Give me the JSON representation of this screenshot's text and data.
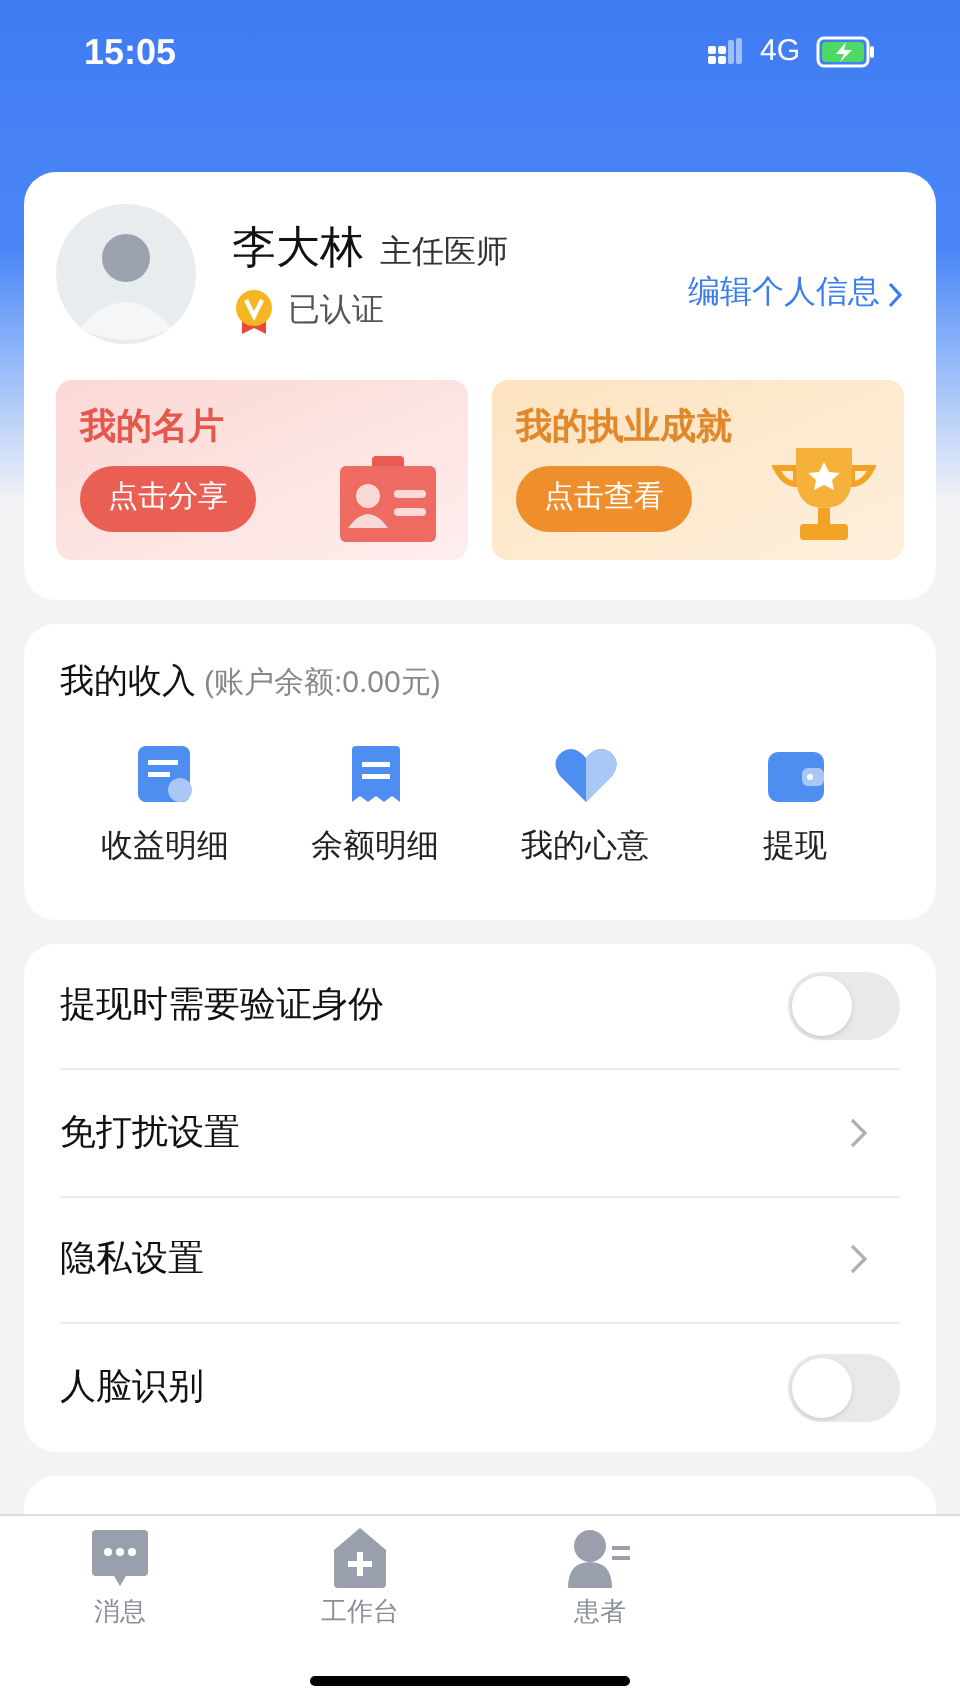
{
  "status_bar": {
    "time": "15:05",
    "network": "4G"
  },
  "profile": {
    "name": "李大林",
    "title": "主任医师",
    "verified": true,
    "verified_label": "已认证",
    "edit_link": "编辑个人信息"
  },
  "promo_cards": [
    {
      "kind": "card",
      "title": "我的名片",
      "button": "点击分享"
    },
    {
      "kind": "trophy",
      "title": "我的执业成就",
      "button": "点击查看"
    }
  ],
  "income": {
    "title": "我的收入",
    "balance": "(账户余额:0.00元)",
    "items": [
      {
        "kind": "income",
        "label": "收益明细"
      },
      {
        "kind": "receipt",
        "label": "余额明细"
      },
      {
        "kind": "heart",
        "label": "我的心意"
      },
      {
        "kind": "wallet",
        "label": "提现"
      }
    ]
  },
  "settings": [
    {
      "kind": "toggle",
      "label": "提现时需要验证身份",
      "on": false
    },
    {
      "kind": "link",
      "label": "免打扰设置"
    },
    {
      "kind": "link",
      "label": "隐私设置"
    },
    {
      "kind": "toggle",
      "label": "人脸识别",
      "on": false
    }
  ],
  "tab_bar": [
    {
      "kind": "message",
      "label": "消息",
      "selected": false
    },
    {
      "kind": "workbench",
      "label": "工作台",
      "selected": false
    },
    {
      "kind": "patient",
      "label": "患者",
      "selected": false
    }
  ]
}
